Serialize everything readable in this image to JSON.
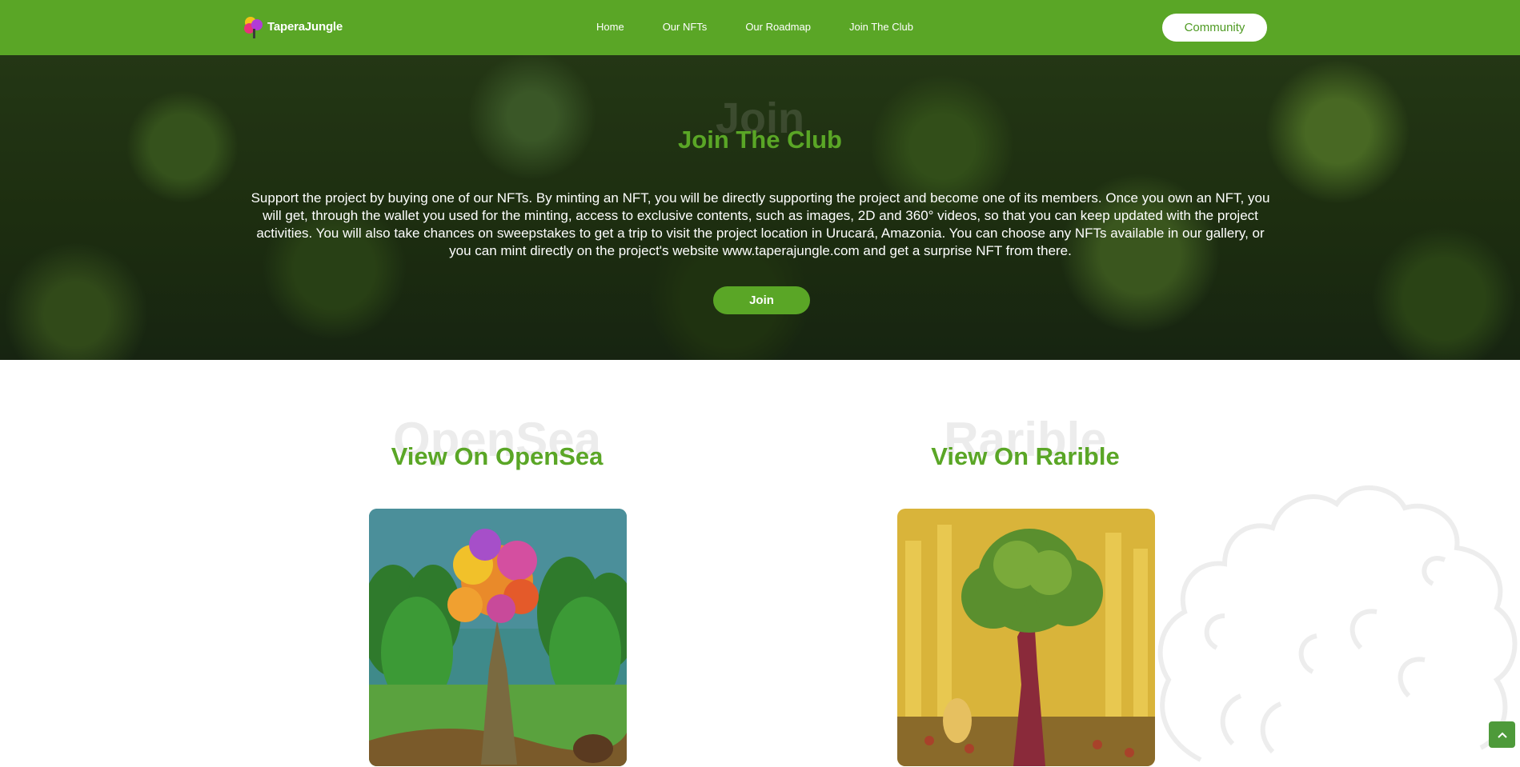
{
  "nav": {
    "logo_text": "TaperaJungle",
    "items": [
      {
        "label": "Home"
      },
      {
        "label": "Our NFTs"
      },
      {
        "label": "Our Roadmap"
      },
      {
        "label": "Join The Club"
      }
    ],
    "community_label": "Community"
  },
  "hero": {
    "ghost_text": "Join",
    "title": "Join The Club",
    "text": "Support the project by buying one of our NFTs. By minting an NFT, you will be directly supporting the project and become one of its members. Once you own an NFT, you will get, through the wallet you used for the minting, access to exclusive contents, such as images, 2D and 360° videos, so that you can keep updated with the project activities. You will also take chances on sweepstakes to get a trip to visit the project location in Urucará, Amazonia. You can choose any NFTs available in our gallery, or you can mint directly on the project's website www.taperajungle.com and get a surprise NFT from there.",
    "join_label": "Join"
  },
  "gallery": {
    "opensea": {
      "ghost": "OpenSea",
      "title": "View On OpenSea"
    },
    "rarible": {
      "ghost": "Rarible",
      "title": "View On Rarible"
    }
  },
  "colors": {
    "brand_green": "#5aa626",
    "white": "#ffffff"
  },
  "icons": {
    "scroll_top": "chevron-up-icon",
    "logo": "tapera-jungle-logo"
  }
}
